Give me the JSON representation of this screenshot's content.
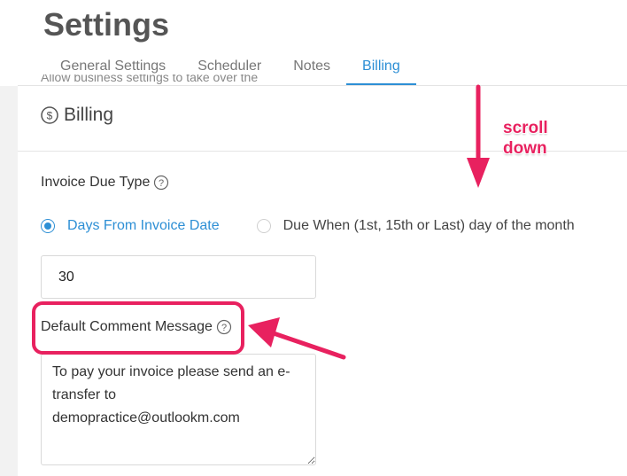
{
  "page": {
    "title": "Settings"
  },
  "tabs": [
    {
      "label": "General Settings",
      "active": false
    },
    {
      "label": "Scheduler",
      "active": false
    },
    {
      "label": "Notes",
      "active": false
    },
    {
      "label": "Billing",
      "active": true
    }
  ],
  "cut_off_text": "Allow business settings to take over the",
  "billing": {
    "icon": "dollar-circle-icon",
    "title": "Billing",
    "invoice_due_type": {
      "label": "Invoice Due Type",
      "options": [
        {
          "label": "Days From Invoice Date",
          "checked": true
        },
        {
          "label": "Due When (1st, 15th or Last) day of the month",
          "checked": false
        }
      ],
      "days_value": "30"
    },
    "default_comment": {
      "label": "Default Comment Message",
      "value": "To pay your invoice please send an e-transfer to demopractice@outlookm.com"
    }
  },
  "annotation": {
    "scroll_line1": "scroll",
    "scroll_line2": "down",
    "color": "#e8215f"
  },
  "colors": {
    "accent": "#2d8fd5",
    "annotation": "#e8215f"
  }
}
